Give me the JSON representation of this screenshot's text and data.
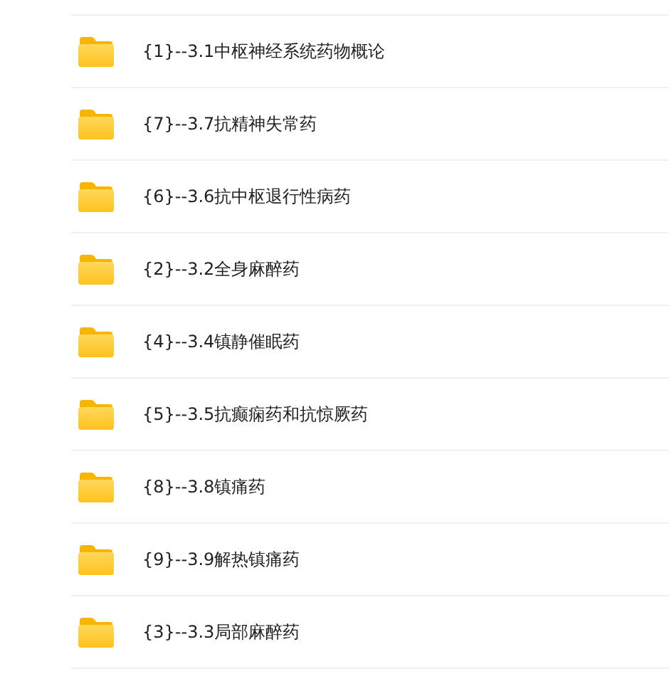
{
  "folders": [
    {
      "name": "{1}--3.1中枢神经系统药物概论"
    },
    {
      "name": "{7}--3.7抗精神失常药"
    },
    {
      "name": "{6}--3.6抗中枢退行性病药"
    },
    {
      "name": "{2}--3.2全身麻醉药"
    },
    {
      "name": "{4}--3.4镇静催眠药"
    },
    {
      "name": "{5}--3.5抗癫痫药和抗惊厥药"
    },
    {
      "name": "{8}--3.8镇痛药"
    },
    {
      "name": "{9}--3.9解热镇痛药"
    },
    {
      "name": "{3}--3.3局部麻醉药"
    }
  ]
}
